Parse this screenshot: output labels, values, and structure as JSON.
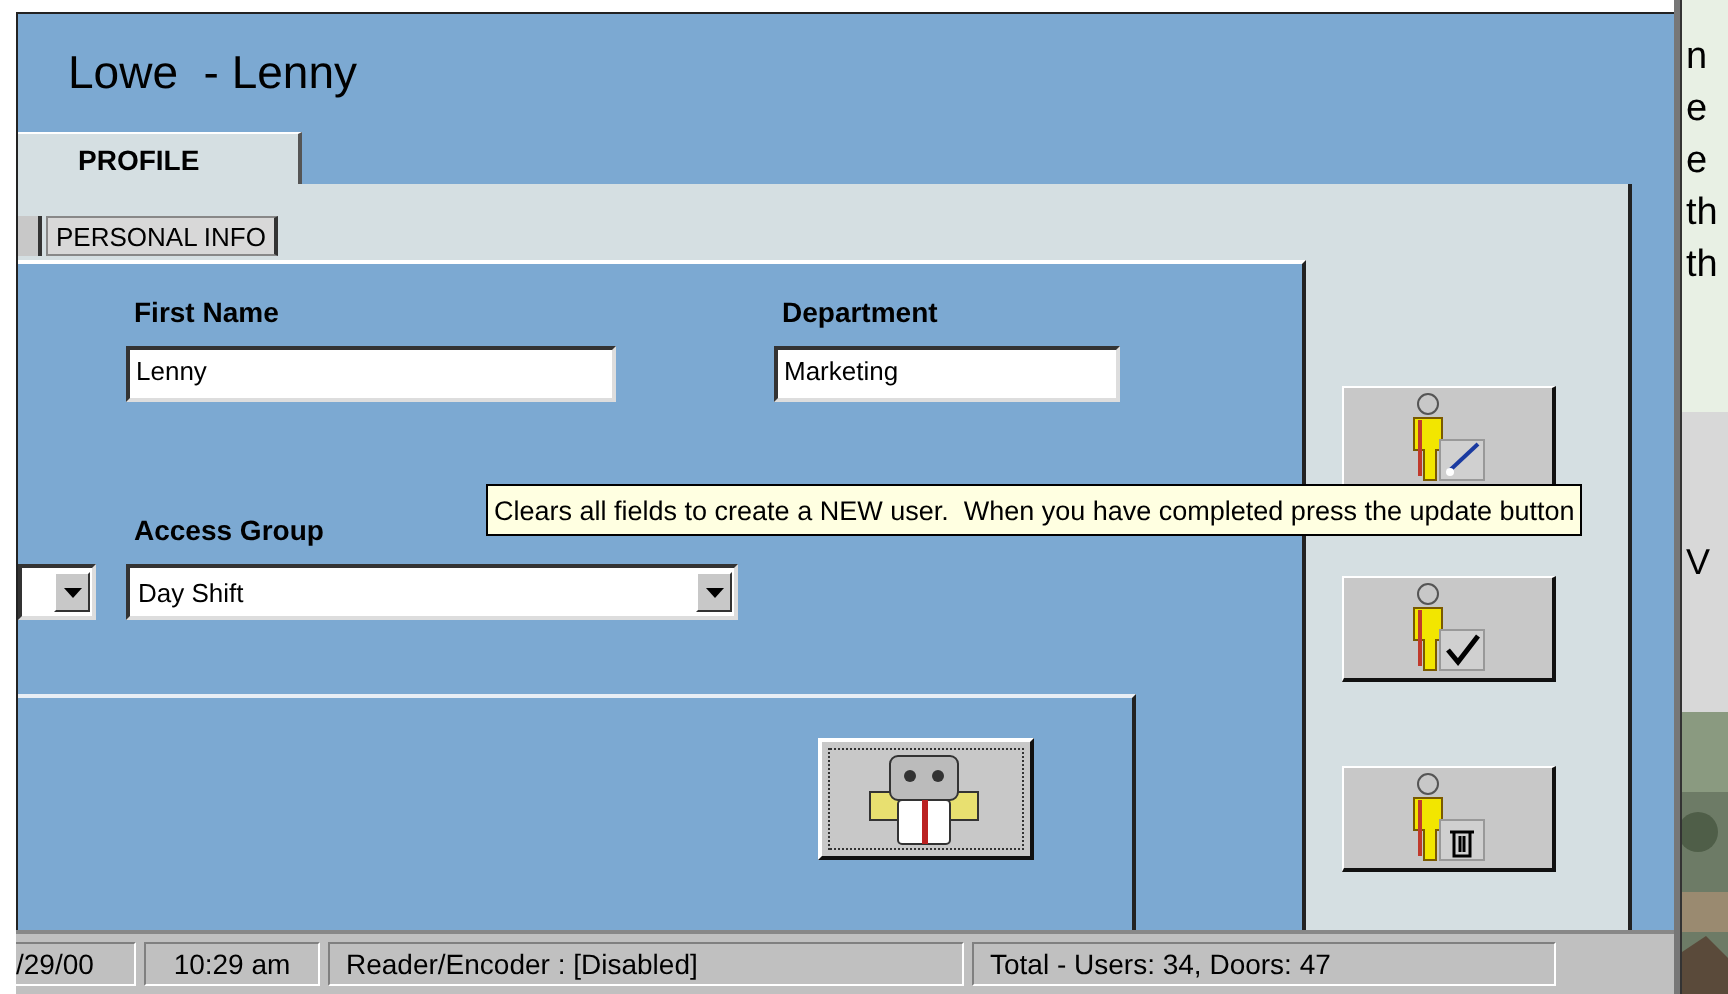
{
  "window": {
    "title": "Lowe  - Lenny"
  },
  "tabs": [
    {
      "label": "PROFILE",
      "selected": true
    }
  ],
  "subtabs": [
    {
      "label": "PERSONAL INFO",
      "selected": true
    }
  ],
  "fields": [
    {
      "label": "First Name",
      "value": "Lenny"
    },
    {
      "label": "Department",
      "value": "Marketing"
    }
  ],
  "access_group": {
    "label": "Access Group",
    "value": "Day Shift"
  },
  "action_buttons": [
    {
      "kind": "edit"
    },
    {
      "kind": "check"
    },
    {
      "kind": "delete"
    }
  ],
  "tooltip": "Clears all fields to create a NEW user.  When you have completed press the update button",
  "status_bar": [
    "/29/00",
    "10:29 am",
    "Reader/Encoder : [Disabled]",
    "Total - Users: 34, Doors: 47"
  ],
  "background_window": {
    "lines": [
      "n",
      "e",
      "e",
      "th",
      "th"
    ],
    "label": "V"
  }
}
